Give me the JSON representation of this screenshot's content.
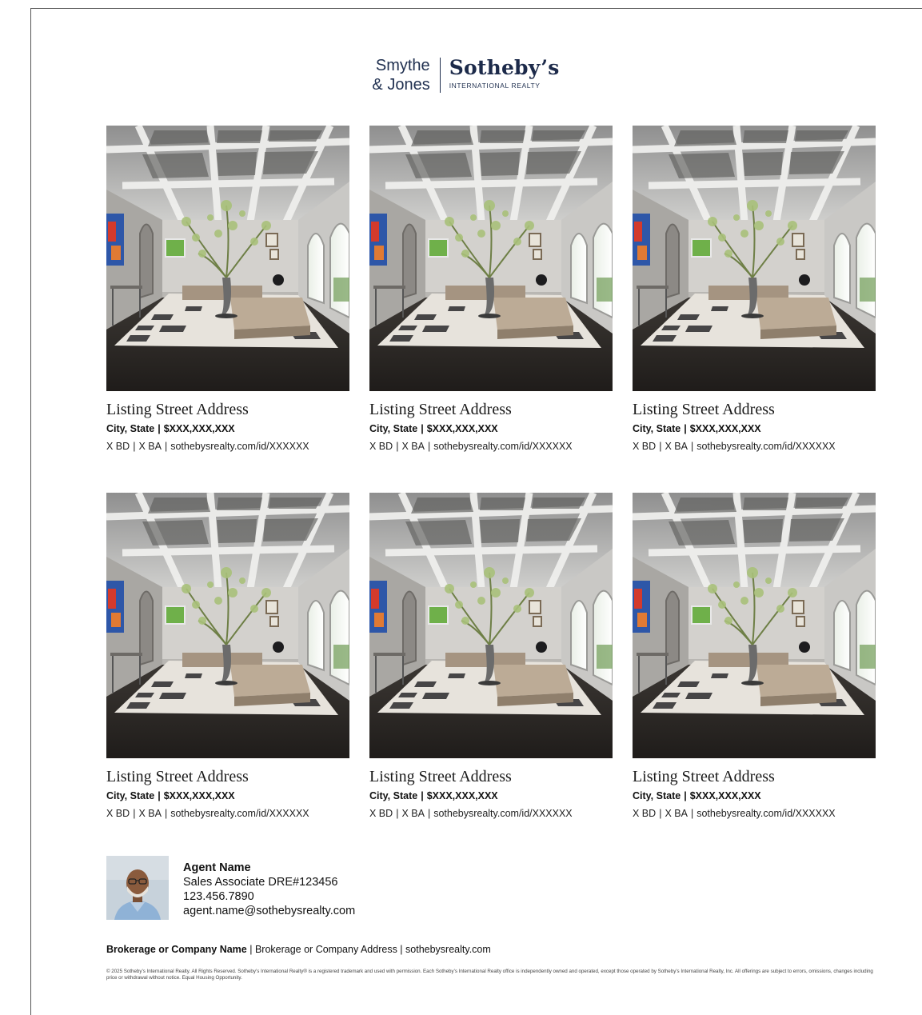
{
  "logo": {
    "partner_line1": "Smythe",
    "partner_line2": "& Jones",
    "brand": "Sotheby’s",
    "brand_sub": "INTERNATIONAL REALTY"
  },
  "listings": [
    {
      "address": "Listing Street Address",
      "city": "City, State",
      "price": "$XXX,XXX,XXX",
      "beds": "X BD",
      "baths": "X BA",
      "url": "sothebysrealty.com/id/XXXXXX"
    },
    {
      "address": "Listing Street Address",
      "city": "City, State",
      "price": "$XXX,XXX,XXX",
      "beds": "X BD",
      "baths": "X BA",
      "url": "sothebysrealty.com/id/XXXXXX"
    },
    {
      "address": "Listing Street Address",
      "city": "City, State",
      "price": "$XXX,XXX,XXX",
      "beds": "X BD",
      "baths": "X BA",
      "url": "sothebysrealty.com/id/XXXXXX"
    },
    {
      "address": "Listing Street Address",
      "city": "City, State",
      "price": "$XXX,XXX,XXX",
      "beds": "X BD",
      "baths": "X BA",
      "url": "sothebysrealty.com/id/XXXXXX"
    },
    {
      "address": "Listing Street Address",
      "city": "City, State",
      "price": "$XXX,XXX,XXX",
      "beds": "X BD",
      "baths": "X BA",
      "url": "sothebysrealty.com/id/XXXXXX"
    },
    {
      "address": "Listing Street Address",
      "city": "City, State",
      "price": "$XXX,XXX,XXX",
      "beds": "X BD",
      "baths": "X BA",
      "url": "sothebysrealty.com/id/XXXXXX"
    }
  ],
  "separator": "|",
  "agent": {
    "name": "Agent Name",
    "title": "Sales Associate DRE#123456",
    "phone": "123.456.7890",
    "email": "agent.name@sothebysrealty.com"
  },
  "brokerage": {
    "name": "Brokerage or Company Name",
    "rest": " | Brokerage or Company Address | sothebysrealty.com"
  },
  "legal": "© 2025 Sotheby’s International Realty. All Rights Reserved. Sotheby’s International Realty® is a registered trademark and used with permission. Each Sotheby’s International Realty office is independently owned and operated, except those operated by Sotheby’s International Realty, Inc. All offerings are subject to errors, omissions, changes including price or withdrawal without notice. Equal Housing Opportunity.",
  "colors": {
    "brand_navy": "#1c2a4a",
    "text": "#111111"
  }
}
